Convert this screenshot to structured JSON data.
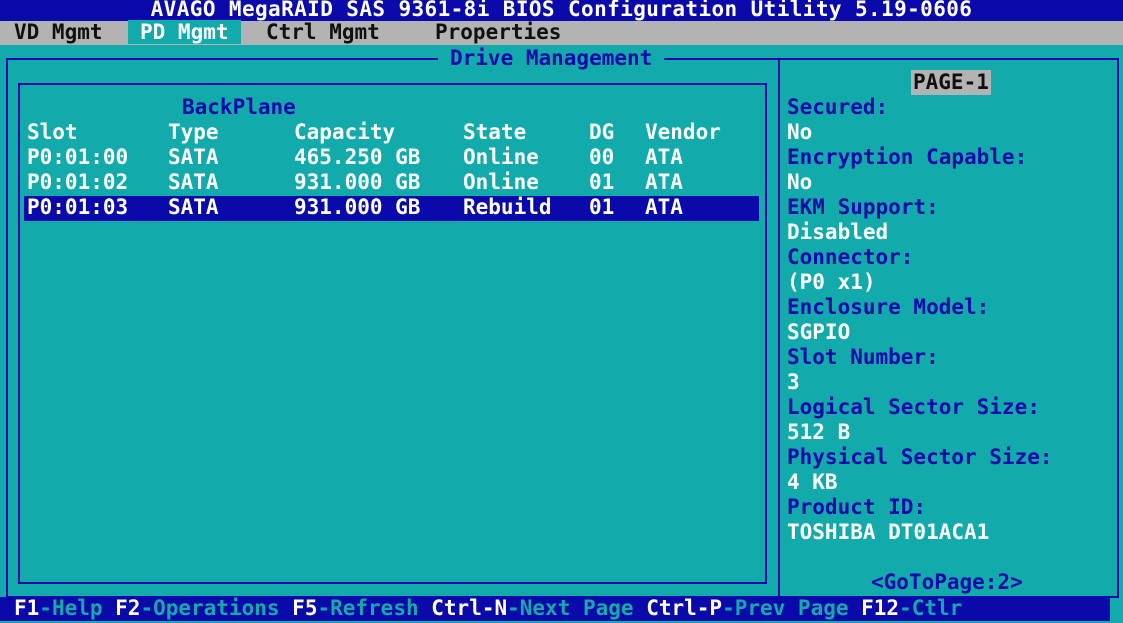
{
  "title": "AVAGO MegaRAID SAS 9361-8i BIOS Configuration Utility 5.19-0606",
  "menu": [
    {
      "label": "VD Mgmt"
    },
    {
      "label": "PD Mgmt"
    },
    {
      "label": "Ctrl Mgmt"
    },
    {
      "label": "Properties"
    }
  ],
  "drive_panel": {
    "title": "Drive Management",
    "group_label": "BackPlane",
    "columns": [
      "Slot",
      "Type",
      "Capacity",
      "State",
      "DG",
      "Vendor"
    ],
    "rows": [
      [
        "P0:01:00",
        "SATA",
        "465.250 GB",
        "Online",
        "00",
        "ATA"
      ],
      [
        "P0:01:02",
        "SATA",
        "931.000 GB",
        "Online",
        "01",
        "ATA"
      ],
      [
        "P0:01:03",
        "SATA",
        "931.000 GB",
        "Rebuild",
        "01",
        "ATA"
      ]
    ],
    "selected_row": 2
  },
  "properties": {
    "page": "PAGE-1",
    "items": [
      {
        "label": "Secured:",
        "value": "No"
      },
      {
        "label": "Encryption Capable:",
        "value": "No"
      },
      {
        "label": "EKM Support:",
        "value": "Disabled"
      },
      {
        "label": "Connector:",
        "value": "(P0 x1)"
      },
      {
        "label": "Enclosure Model:",
        "value": "SGPIO"
      },
      {
        "label": "Slot Number:",
        "value": "3"
      },
      {
        "label": "Logical Sector Size:",
        "value": "512 B"
      },
      {
        "label": "Physical Sector Size:",
        "value": "4 KB"
      },
      {
        "label": "Product ID:",
        "value": "TOSHIBA DT01ACA1"
      }
    ],
    "goto": "<GoToPage:2>"
  },
  "statusbar": [
    {
      "key": "F1",
      "desc": "-Help "
    },
    {
      "key": "F2",
      "desc": "-Operations "
    },
    {
      "key": "F5",
      "desc": "-Refresh "
    },
    {
      "key": "Ctrl-N",
      "desc": "-Next Page "
    },
    {
      "key": "Ctrl-P",
      "desc": "-Prev Page "
    },
    {
      "key": "F12",
      "desc": "-Ctlr"
    }
  ],
  "colors": {
    "background": "#12aaaa",
    "frame": "#0a0aaa",
    "title_bar": "#0a0aaa",
    "menu_bar": "#b3b3b3",
    "text": "#ffffff",
    "label": "#0a0aaa"
  }
}
